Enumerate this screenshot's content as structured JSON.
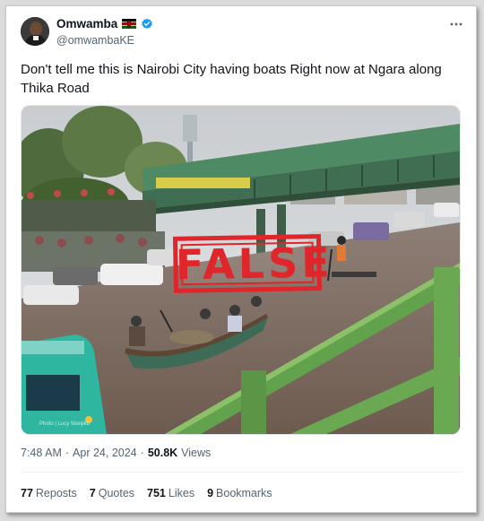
{
  "author": {
    "display_name": "Omwamba",
    "handle": "@omwambaKE",
    "icons": [
      "kenya-flag-icon",
      "verified-badge-icon"
    ]
  },
  "tweet": {
    "text": "Don't tell me this is Nairobi City having boats Right now at Ngara along Thika Road"
  },
  "media": {
    "stamp_text": "FALSE",
    "watermark": "Photo | Lucy Wanjiku"
  },
  "meta": {
    "time": "7:48 AM",
    "separator": "·",
    "date": "Apr 24, 2024",
    "views_count": "50.8K",
    "views_label": "Views"
  },
  "stats": {
    "reposts_count": "77",
    "reposts_label": "Reposts",
    "quotes_count": "7",
    "quotes_label": "Quotes",
    "likes_count": "751",
    "likes_label": "Likes",
    "bookmarks_count": "9",
    "bookmarks_label": "Bookmarks"
  },
  "colors": {
    "stamp": "#e0252b",
    "verified": "#1d9bf0",
    "bridge_green": "#4e8a64",
    "water": "#7d6a5e"
  }
}
